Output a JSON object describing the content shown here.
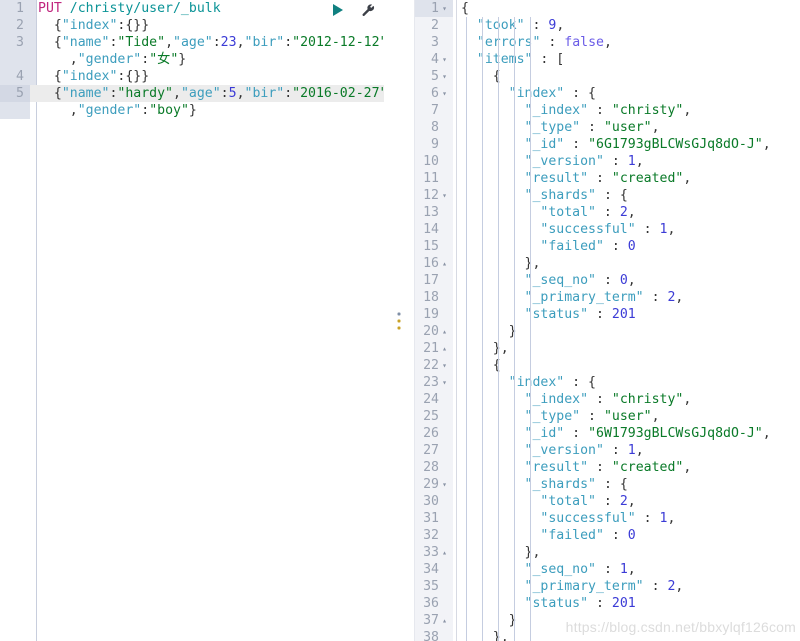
{
  "app": {
    "name": "kibana-dev-tools-console",
    "watermark": "https://blog.csdn.net/bbxylqf126com"
  },
  "toolbar": {
    "play_label": "▶",
    "play_title": "click-to-send-request",
    "wrench_title": "open-documentation-wrench",
    "play_color": "#108080",
    "wrench_color": "#3c4048"
  },
  "request_editor": {
    "name": "request-editor",
    "active_line": 5,
    "lines": [
      {
        "n": "1",
        "tokens": [
          {
            "t": "PUT",
            "c": "k-method"
          },
          {
            "t": " ",
            "c": "k-punct"
          },
          {
            "t": "/christy/user/_bulk",
            "c": "k-url"
          }
        ]
      },
      {
        "n": "2",
        "tokens": [
          {
            "t": "  {",
            "c": "k-punct"
          },
          {
            "t": "\"index\"",
            "c": "k-key"
          },
          {
            "t": ":{}}",
            "c": "k-punct"
          }
        ]
      },
      {
        "n": "3",
        "tokens": [
          {
            "t": "  {",
            "c": "k-punct"
          },
          {
            "t": "\"name\"",
            "c": "k-key"
          },
          {
            "t": ":",
            "c": "k-punct"
          },
          {
            "t": "\"Tide\"",
            "c": "k-str"
          },
          {
            "t": ",",
            "c": "k-punct"
          },
          {
            "t": "\"age\"",
            "c": "k-key"
          },
          {
            "t": ":",
            "c": "k-punct"
          },
          {
            "t": "23",
            "c": "k-num"
          },
          {
            "t": ",",
            "c": "k-punct"
          },
          {
            "t": "\"bir\"",
            "c": "k-key"
          },
          {
            "t": ":",
            "c": "k-punct"
          },
          {
            "t": "\"2012-12-12\"",
            "c": "k-str"
          }
        ]
      },
      {
        "n": "",
        "tokens": [
          {
            "t": "    ,",
            "c": "k-punct"
          },
          {
            "t": "\"gender\"",
            "c": "k-key"
          },
          {
            "t": ":",
            "c": "k-punct"
          },
          {
            "t": "\"女\"",
            "c": "k-str"
          },
          {
            "t": "}",
            "c": "k-punct"
          }
        ]
      },
      {
        "n": "4",
        "tokens": [
          {
            "t": "  {",
            "c": "k-punct"
          },
          {
            "t": "\"index\"",
            "c": "k-key"
          },
          {
            "t": ":{}}",
            "c": "k-punct"
          }
        ]
      },
      {
        "n": "5",
        "tokens": [
          {
            "t": "  {",
            "c": "k-punct"
          },
          {
            "t": "\"name\"",
            "c": "k-key"
          },
          {
            "t": ":",
            "c": "k-punct"
          },
          {
            "t": "\"hardy\"",
            "c": "k-str"
          },
          {
            "t": ",",
            "c": "k-punct"
          },
          {
            "t": "\"age\"",
            "c": "k-key"
          },
          {
            "t": ":",
            "c": "k-punct"
          },
          {
            "t": "5",
            "c": "k-num"
          },
          {
            "t": ",",
            "c": "k-punct"
          },
          {
            "t": "\"bir\"",
            "c": "k-key"
          },
          {
            "t": ":",
            "c": "k-punct"
          },
          {
            "t": "\"2016-02-27\"",
            "c": "k-str"
          }
        ]
      },
      {
        "n": "",
        "tokens": [
          {
            "t": "    ,",
            "c": "k-punct"
          },
          {
            "t": "\"gender\"",
            "c": "k-key"
          },
          {
            "t": ":",
            "c": "k-punct"
          },
          {
            "t": "\"boy\"",
            "c": "k-str"
          },
          {
            "t": "}",
            "c": "k-punct"
          }
        ]
      }
    ]
  },
  "response_editor": {
    "name": "response-editor",
    "active_line": 1,
    "lines": [
      {
        "n": "1",
        "fold": "▾",
        "indent": 0,
        "tokens": [
          {
            "t": "{",
            "c": "k-punct"
          }
        ]
      },
      {
        "n": "2",
        "fold": "",
        "indent": 1,
        "tokens": [
          {
            "t": "  ",
            "c": "k-punct"
          },
          {
            "t": "\"took\"",
            "c": "k-key"
          },
          {
            "t": " : ",
            "c": "k-punct"
          },
          {
            "t": "9",
            "c": "k-num"
          },
          {
            "t": ",",
            "c": "k-punct"
          }
        ]
      },
      {
        "n": "3",
        "fold": "",
        "indent": 1,
        "tokens": [
          {
            "t": "  ",
            "c": "k-punct"
          },
          {
            "t": "\"errors\"",
            "c": "k-key"
          },
          {
            "t": " : ",
            "c": "k-punct"
          },
          {
            "t": "false",
            "c": "k-bool"
          },
          {
            "t": ",",
            "c": "k-punct"
          }
        ]
      },
      {
        "n": "4",
        "fold": "▾",
        "indent": 1,
        "tokens": [
          {
            "t": "  ",
            "c": "k-punct"
          },
          {
            "t": "\"items\"",
            "c": "k-key"
          },
          {
            "t": " : [",
            "c": "k-punct"
          }
        ]
      },
      {
        "n": "5",
        "fold": "▾",
        "indent": 2,
        "tokens": [
          {
            "t": "    {",
            "c": "k-punct"
          }
        ]
      },
      {
        "n": "6",
        "fold": "▾",
        "indent": 3,
        "tokens": [
          {
            "t": "      ",
            "c": "k-punct"
          },
          {
            "t": "\"index\"",
            "c": "k-key"
          },
          {
            "t": " : {",
            "c": "k-punct"
          }
        ]
      },
      {
        "n": "7",
        "fold": "",
        "indent": 4,
        "tokens": [
          {
            "t": "        ",
            "c": "k-punct"
          },
          {
            "t": "\"_index\"",
            "c": "k-key"
          },
          {
            "t": " : ",
            "c": "k-punct"
          },
          {
            "t": "\"christy\"",
            "c": "k-str"
          },
          {
            "t": ",",
            "c": "k-punct"
          }
        ]
      },
      {
        "n": "8",
        "fold": "",
        "indent": 4,
        "tokens": [
          {
            "t": "        ",
            "c": "k-punct"
          },
          {
            "t": "\"_type\"",
            "c": "k-key"
          },
          {
            "t": " : ",
            "c": "k-punct"
          },
          {
            "t": "\"user\"",
            "c": "k-str"
          },
          {
            "t": ",",
            "c": "k-punct"
          }
        ]
      },
      {
        "n": "9",
        "fold": "",
        "indent": 4,
        "tokens": [
          {
            "t": "        ",
            "c": "k-punct"
          },
          {
            "t": "\"_id\"",
            "c": "k-key"
          },
          {
            "t": " : ",
            "c": "k-punct"
          },
          {
            "t": "\"6G1793gBLCWsGJq8dO-J\"",
            "c": "k-str"
          },
          {
            "t": ",",
            "c": "k-punct"
          }
        ]
      },
      {
        "n": "10",
        "fold": "",
        "indent": 4,
        "tokens": [
          {
            "t": "        ",
            "c": "k-punct"
          },
          {
            "t": "\"_version\"",
            "c": "k-key"
          },
          {
            "t": " : ",
            "c": "k-punct"
          },
          {
            "t": "1",
            "c": "k-num"
          },
          {
            "t": ",",
            "c": "k-punct"
          }
        ]
      },
      {
        "n": "11",
        "fold": "",
        "indent": 4,
        "tokens": [
          {
            "t": "        ",
            "c": "k-punct"
          },
          {
            "t": "\"result\"",
            "c": "k-key"
          },
          {
            "t": " : ",
            "c": "k-punct"
          },
          {
            "t": "\"created\"",
            "c": "k-str"
          },
          {
            "t": ",",
            "c": "k-punct"
          }
        ]
      },
      {
        "n": "12",
        "fold": "▾",
        "indent": 4,
        "tokens": [
          {
            "t": "        ",
            "c": "k-punct"
          },
          {
            "t": "\"_shards\"",
            "c": "k-key"
          },
          {
            "t": " : {",
            "c": "k-punct"
          }
        ]
      },
      {
        "n": "13",
        "fold": "",
        "indent": 5,
        "tokens": [
          {
            "t": "          ",
            "c": "k-punct"
          },
          {
            "t": "\"total\"",
            "c": "k-key"
          },
          {
            "t": " : ",
            "c": "k-punct"
          },
          {
            "t": "2",
            "c": "k-num"
          },
          {
            "t": ",",
            "c": "k-punct"
          }
        ]
      },
      {
        "n": "14",
        "fold": "",
        "indent": 5,
        "tokens": [
          {
            "t": "          ",
            "c": "k-punct"
          },
          {
            "t": "\"successful\"",
            "c": "k-key"
          },
          {
            "t": " : ",
            "c": "k-punct"
          },
          {
            "t": "1",
            "c": "k-num"
          },
          {
            "t": ",",
            "c": "k-punct"
          }
        ]
      },
      {
        "n": "15",
        "fold": "",
        "indent": 5,
        "tokens": [
          {
            "t": "          ",
            "c": "k-punct"
          },
          {
            "t": "\"failed\"",
            "c": "k-key"
          },
          {
            "t": " : ",
            "c": "k-punct"
          },
          {
            "t": "0",
            "c": "k-num"
          }
        ]
      },
      {
        "n": "16",
        "fold": "▴",
        "indent": 4,
        "tokens": [
          {
            "t": "        },",
            "c": "k-punct"
          }
        ]
      },
      {
        "n": "17",
        "fold": "",
        "indent": 4,
        "tokens": [
          {
            "t": "        ",
            "c": "k-punct"
          },
          {
            "t": "\"_seq_no\"",
            "c": "k-key"
          },
          {
            "t": " : ",
            "c": "k-punct"
          },
          {
            "t": "0",
            "c": "k-num"
          },
          {
            "t": ",",
            "c": "k-punct"
          }
        ]
      },
      {
        "n": "18",
        "fold": "",
        "indent": 4,
        "tokens": [
          {
            "t": "        ",
            "c": "k-punct"
          },
          {
            "t": "\"_primary_term\"",
            "c": "k-key"
          },
          {
            "t": " : ",
            "c": "k-punct"
          },
          {
            "t": "2",
            "c": "k-num"
          },
          {
            "t": ",",
            "c": "k-punct"
          }
        ]
      },
      {
        "n": "19",
        "fold": "",
        "indent": 4,
        "tokens": [
          {
            "t": "        ",
            "c": "k-punct"
          },
          {
            "t": "\"status\"",
            "c": "k-key"
          },
          {
            "t": " : ",
            "c": "k-punct"
          },
          {
            "t": "201",
            "c": "k-num"
          }
        ]
      },
      {
        "n": "20",
        "fold": "▴",
        "indent": 3,
        "tokens": [
          {
            "t": "      }",
            "c": "k-punct"
          }
        ]
      },
      {
        "n": "21",
        "fold": "▴",
        "indent": 2,
        "tokens": [
          {
            "t": "    },",
            "c": "k-punct"
          }
        ]
      },
      {
        "n": "22",
        "fold": "▾",
        "indent": 2,
        "tokens": [
          {
            "t": "    {",
            "c": "k-punct"
          }
        ]
      },
      {
        "n": "23",
        "fold": "▾",
        "indent": 3,
        "tokens": [
          {
            "t": "      ",
            "c": "k-punct"
          },
          {
            "t": "\"index\"",
            "c": "k-key"
          },
          {
            "t": " : {",
            "c": "k-punct"
          }
        ]
      },
      {
        "n": "24",
        "fold": "",
        "indent": 4,
        "tokens": [
          {
            "t": "        ",
            "c": "k-punct"
          },
          {
            "t": "\"_index\"",
            "c": "k-key"
          },
          {
            "t": " : ",
            "c": "k-punct"
          },
          {
            "t": "\"christy\"",
            "c": "k-str"
          },
          {
            "t": ",",
            "c": "k-punct"
          }
        ]
      },
      {
        "n": "25",
        "fold": "",
        "indent": 4,
        "tokens": [
          {
            "t": "        ",
            "c": "k-punct"
          },
          {
            "t": "\"_type\"",
            "c": "k-key"
          },
          {
            "t": " : ",
            "c": "k-punct"
          },
          {
            "t": "\"user\"",
            "c": "k-str"
          },
          {
            "t": ",",
            "c": "k-punct"
          }
        ]
      },
      {
        "n": "26",
        "fold": "",
        "indent": 4,
        "tokens": [
          {
            "t": "        ",
            "c": "k-punct"
          },
          {
            "t": "\"_id\"",
            "c": "k-key"
          },
          {
            "t": " : ",
            "c": "k-punct"
          },
          {
            "t": "\"6W1793gBLCWsGJq8dO-J\"",
            "c": "k-str"
          },
          {
            "t": ",",
            "c": "k-punct"
          }
        ]
      },
      {
        "n": "27",
        "fold": "",
        "indent": 4,
        "tokens": [
          {
            "t": "        ",
            "c": "k-punct"
          },
          {
            "t": "\"_version\"",
            "c": "k-key"
          },
          {
            "t": " : ",
            "c": "k-punct"
          },
          {
            "t": "1",
            "c": "k-num"
          },
          {
            "t": ",",
            "c": "k-punct"
          }
        ]
      },
      {
        "n": "28",
        "fold": "",
        "indent": 4,
        "tokens": [
          {
            "t": "        ",
            "c": "k-punct"
          },
          {
            "t": "\"result\"",
            "c": "k-key"
          },
          {
            "t": " : ",
            "c": "k-punct"
          },
          {
            "t": "\"created\"",
            "c": "k-str"
          },
          {
            "t": ",",
            "c": "k-punct"
          }
        ]
      },
      {
        "n": "29",
        "fold": "▾",
        "indent": 4,
        "tokens": [
          {
            "t": "        ",
            "c": "k-punct"
          },
          {
            "t": "\"_shards\"",
            "c": "k-key"
          },
          {
            "t": " : {",
            "c": "k-punct"
          }
        ]
      },
      {
        "n": "30",
        "fold": "",
        "indent": 5,
        "tokens": [
          {
            "t": "          ",
            "c": "k-punct"
          },
          {
            "t": "\"total\"",
            "c": "k-key"
          },
          {
            "t": " : ",
            "c": "k-punct"
          },
          {
            "t": "2",
            "c": "k-num"
          },
          {
            "t": ",",
            "c": "k-punct"
          }
        ]
      },
      {
        "n": "31",
        "fold": "",
        "indent": 5,
        "tokens": [
          {
            "t": "          ",
            "c": "k-punct"
          },
          {
            "t": "\"successful\"",
            "c": "k-key"
          },
          {
            "t": " : ",
            "c": "k-punct"
          },
          {
            "t": "1",
            "c": "k-num"
          },
          {
            "t": ",",
            "c": "k-punct"
          }
        ]
      },
      {
        "n": "32",
        "fold": "",
        "indent": 5,
        "tokens": [
          {
            "t": "          ",
            "c": "k-punct"
          },
          {
            "t": "\"failed\"",
            "c": "k-key"
          },
          {
            "t": " : ",
            "c": "k-punct"
          },
          {
            "t": "0",
            "c": "k-num"
          }
        ]
      },
      {
        "n": "33",
        "fold": "▴",
        "indent": 4,
        "tokens": [
          {
            "t": "        },",
            "c": "k-punct"
          }
        ]
      },
      {
        "n": "34",
        "fold": "",
        "indent": 4,
        "tokens": [
          {
            "t": "        ",
            "c": "k-punct"
          },
          {
            "t": "\"_seq_no\"",
            "c": "k-key"
          },
          {
            "t": " : ",
            "c": "k-punct"
          },
          {
            "t": "1",
            "c": "k-num"
          },
          {
            "t": ",",
            "c": "k-punct"
          }
        ]
      },
      {
        "n": "35",
        "fold": "",
        "indent": 4,
        "tokens": [
          {
            "t": "        ",
            "c": "k-punct"
          },
          {
            "t": "\"_primary_term\"",
            "c": "k-key"
          },
          {
            "t": " : ",
            "c": "k-punct"
          },
          {
            "t": "2",
            "c": "k-num"
          },
          {
            "t": ",",
            "c": "k-punct"
          }
        ]
      },
      {
        "n": "36",
        "fold": "",
        "indent": 4,
        "tokens": [
          {
            "t": "        ",
            "c": "k-punct"
          },
          {
            "t": "\"status\"",
            "c": "k-key"
          },
          {
            "t": " : ",
            "c": "k-punct"
          },
          {
            "t": "201",
            "c": "k-num"
          }
        ]
      },
      {
        "n": "37",
        "fold": "▴",
        "indent": 3,
        "tokens": [
          {
            "t": "      }",
            "c": "k-punct"
          }
        ]
      },
      {
        "n": "38",
        "fold": "",
        "indent": 2,
        "tokens": [
          {
            "t": "    },",
            "c": "k-punct"
          }
        ]
      }
    ]
  }
}
